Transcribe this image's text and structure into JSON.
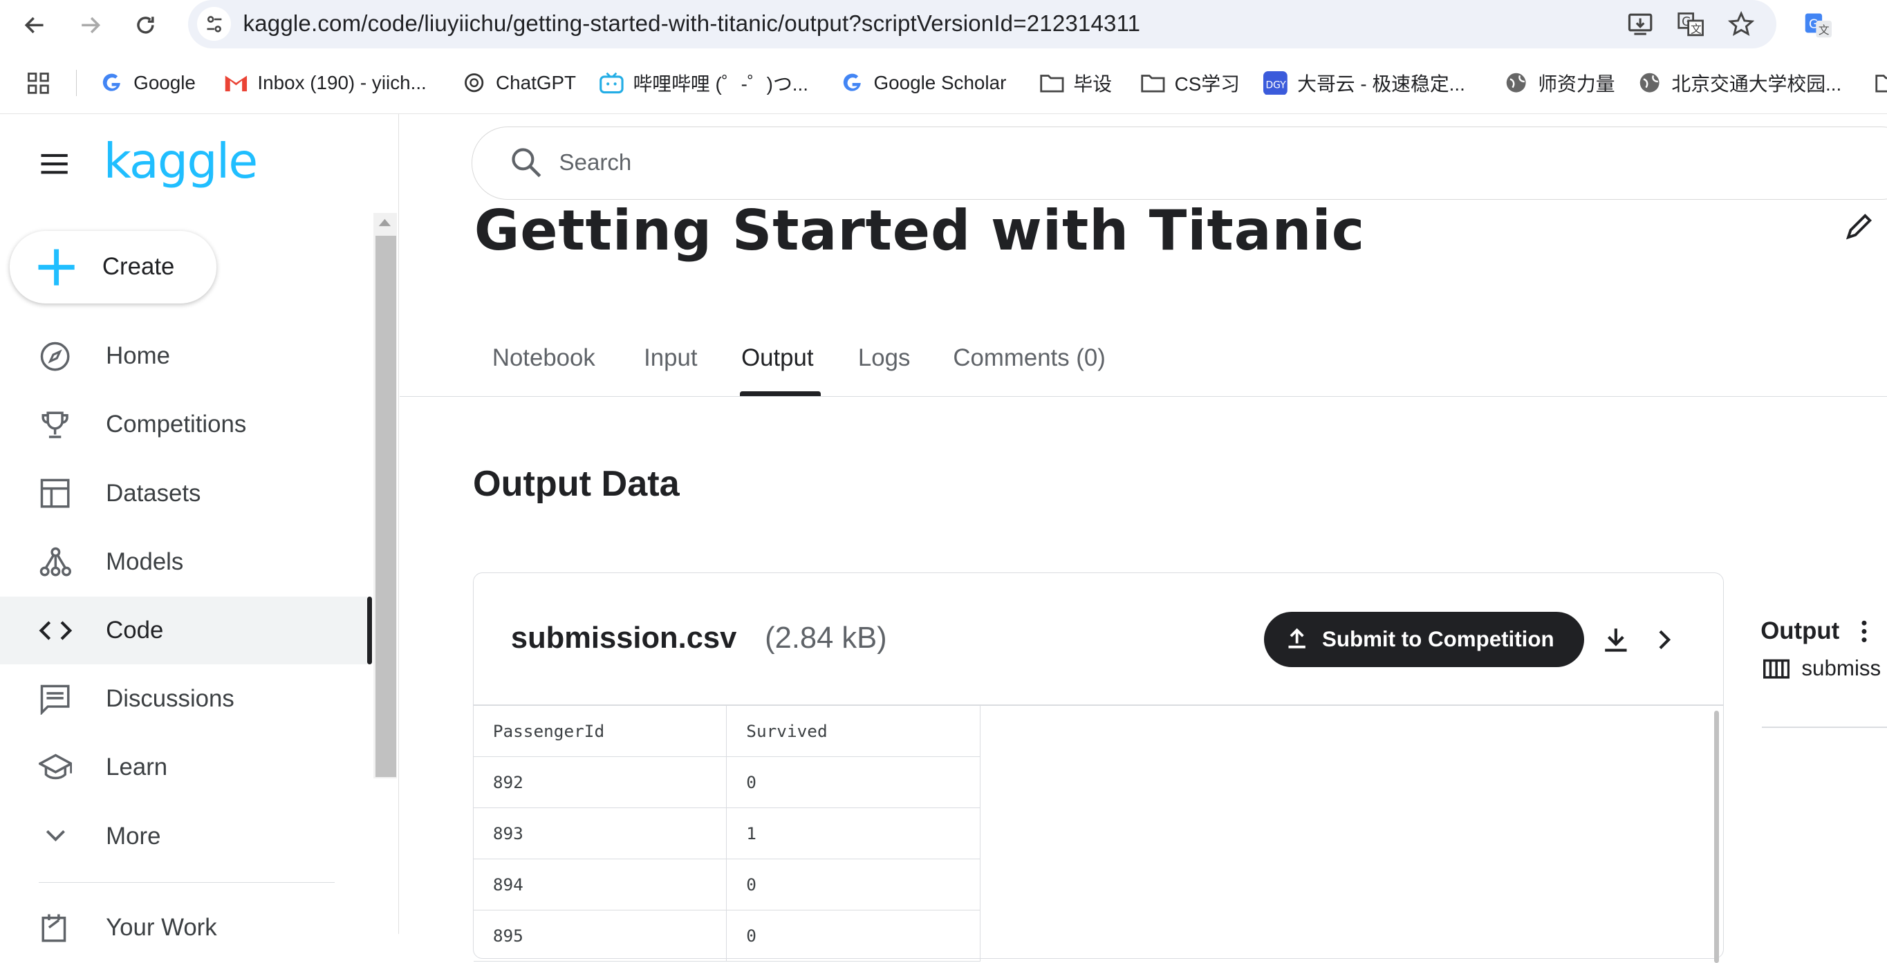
{
  "browser": {
    "url": "kaggle.com/code/liuyiichu/getting-started-with-titanic/output?scriptVersionId=212314311",
    "bookmarks": [
      {
        "label": "Google",
        "icon": "google-icon"
      },
      {
        "label": "Inbox (190) - yiich...",
        "icon": "gmail-icon"
      },
      {
        "label": "ChatGPT",
        "icon": "chatgpt-icon"
      },
      {
        "label": "哔哩哔哩 (゜-゜)つ...",
        "icon": "bilibili-icon"
      },
      {
        "label": "Google Scholar",
        "icon": "google-icon"
      },
      {
        "label": "毕设",
        "icon": "folder-icon"
      },
      {
        "label": "CS学习",
        "icon": "folder-icon"
      },
      {
        "label": "大哥云 - 极速稳定...",
        "icon": "dgy-icon"
      },
      {
        "label": "师资力量",
        "icon": "globe-icon"
      },
      {
        "label": "北京交通大学校园...",
        "icon": "globe-icon"
      }
    ]
  },
  "sidebar": {
    "logo": "kaggle",
    "create_label": "Create",
    "items": [
      {
        "label": "Home",
        "icon": "compass-icon"
      },
      {
        "label": "Competitions",
        "icon": "trophy-icon"
      },
      {
        "label": "Datasets",
        "icon": "table-icon"
      },
      {
        "label": "Models",
        "icon": "models-icon"
      },
      {
        "label": "Code",
        "icon": "code-icon"
      },
      {
        "label": "Discussions",
        "icon": "comment-icon"
      },
      {
        "label": "Learn",
        "icon": "school-icon"
      },
      {
        "label": "More",
        "icon": "chevron-down-icon"
      },
      {
        "label": "Your Work",
        "icon": "edit-note-icon"
      }
    ]
  },
  "search": {
    "placeholder": "Search"
  },
  "notebook": {
    "title": "Getting Started with Titanic",
    "tabs": [
      "Notebook",
      "Input",
      "Output",
      "Logs",
      "Comments (0)"
    ],
    "active_tab": "Output"
  },
  "output": {
    "section_title": "Output Data",
    "file_name": "submission.csv",
    "file_size": "(2.84 kB)",
    "submit_label": "Submit to Competition",
    "columns": [
      "PassengerId",
      "Survived"
    ],
    "rows": [
      [
        "892",
        "0"
      ],
      [
        "893",
        "1"
      ],
      [
        "894",
        "0"
      ],
      [
        "895",
        "0"
      ]
    ]
  },
  "right_panel": {
    "label": "Output",
    "file": "submiss"
  },
  "colors": {
    "kaggle_blue": "#20beff",
    "dark": "#202124"
  }
}
